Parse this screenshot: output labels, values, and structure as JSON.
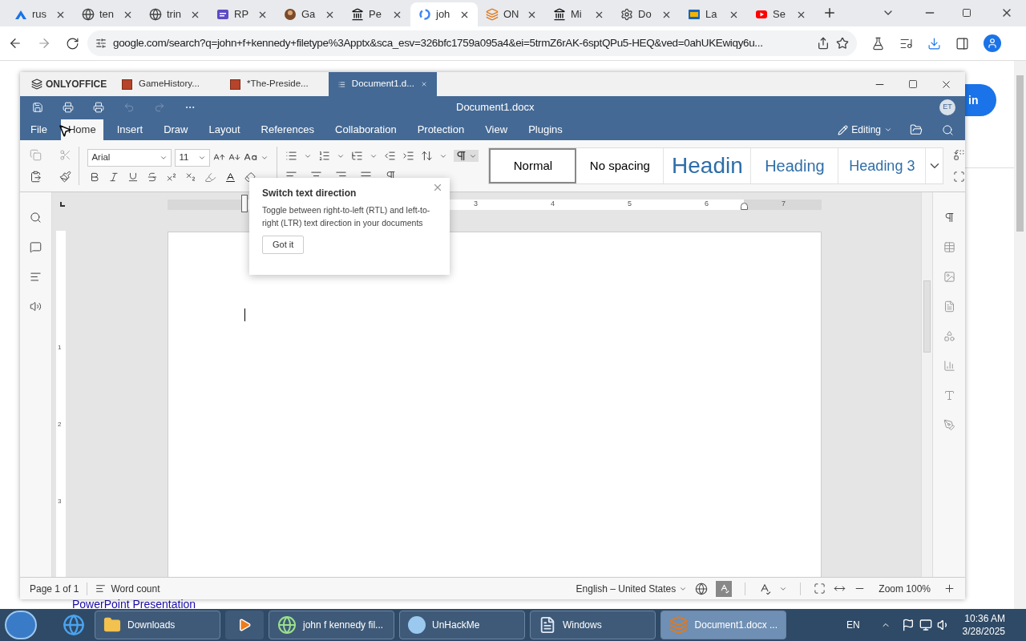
{
  "browser": {
    "tabs": [
      {
        "label": "rus",
        "selected": false
      },
      {
        "label": "ten",
        "selected": false
      },
      {
        "label": "trin",
        "selected": false
      },
      {
        "label": "RP",
        "selected": false
      },
      {
        "label": "Ga",
        "selected": false
      },
      {
        "label": "Pe",
        "selected": false
      },
      {
        "label": "joh",
        "selected": true
      },
      {
        "label": "ON",
        "selected": false
      },
      {
        "label": "Mi",
        "selected": false
      },
      {
        "label": "Do",
        "selected": false
      },
      {
        "label": "La",
        "selected": false
      },
      {
        "label": "Se",
        "selected": false
      }
    ],
    "address": "google.com/search?q=john+f+kennedy+filetype%3Apptx&sca_esv=326bfc1759a095a4&ei=5trmZ6rAK-6sptQPu5-HEQ&ved=0ahUKEwiqy6u..."
  },
  "background_page": {
    "sign_in": "in",
    "result_title": "PowerPoint Presentation"
  },
  "editor": {
    "app_name": "ONLYOFFICE",
    "doc_tabs": [
      {
        "label": "GameHistory...",
        "selected": false
      },
      {
        "label": "*The-Preside...",
        "selected": false
      },
      {
        "label": "Document1.d...",
        "selected": true
      }
    ],
    "title": "Document1.docx",
    "avatar": "ET",
    "menu": [
      {
        "label": "File",
        "selected": false
      },
      {
        "label": "Home",
        "selected": true
      },
      {
        "label": "Insert",
        "selected": false
      },
      {
        "label": "Draw",
        "selected": false
      },
      {
        "label": "Layout",
        "selected": false
      },
      {
        "label": "References",
        "selected": false
      },
      {
        "label": "Collaboration",
        "selected": false
      },
      {
        "label": "Protection",
        "selected": false
      },
      {
        "label": "View",
        "selected": false
      },
      {
        "label": "Plugins",
        "selected": false
      }
    ],
    "mode": "Editing",
    "font": "Arial",
    "font_size": "11",
    "styles": [
      {
        "label": "Normal",
        "kind": "normal",
        "selected": true
      },
      {
        "label": "No spacing",
        "kind": "normal",
        "selected": false
      },
      {
        "label": "Headin",
        "kind": "heading1",
        "selected": false
      },
      {
        "label": "Heading",
        "kind": "heading2",
        "selected": false
      },
      {
        "label": "Heading 3",
        "kind": "heading3",
        "selected": false
      }
    ],
    "ruler_numbers": [
      "3",
      "4",
      "5",
      "6",
      "7"
    ],
    "vertical_ruler_numbers": [
      "1",
      "2",
      "3"
    ],
    "tooltip": {
      "title": "Switch text direction",
      "text": "Toggle between right-to-left (RTL) and left-to-right (LTR) text direction in your documents",
      "button": "Got it"
    },
    "status_bar": {
      "page": "Page 1 of 1",
      "word_count": "Word count",
      "language": "English – United States",
      "zoom": "Zoom 100%"
    }
  },
  "taskbar": {
    "items": [
      {
        "label": "Downloads",
        "selected": false
      },
      {
        "label": "john f kennedy fil...",
        "selected": false
      },
      {
        "label": "UnHackMe",
        "selected": false
      },
      {
        "label": "Windows",
        "selected": false
      },
      {
        "label": "Document1.docx ...",
        "selected": true
      }
    ],
    "language": "EN",
    "time": "10:36 AM",
    "date": "3/28/2025"
  }
}
